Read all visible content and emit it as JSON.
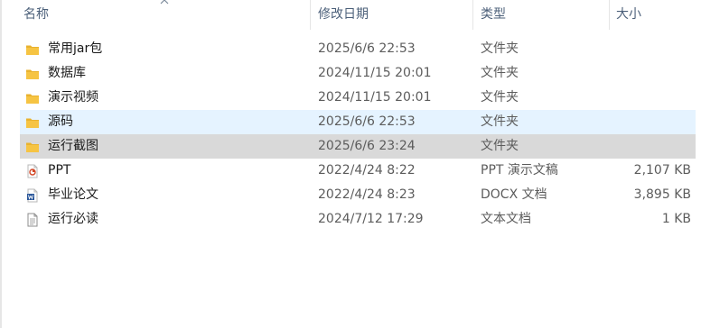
{
  "columns": {
    "name": "名称",
    "date": "修改日期",
    "type": "类型",
    "size": "大小"
  },
  "colors": {
    "hover": "#e5f3ff",
    "selected": "#d9d9d9",
    "folder": "#f6c443",
    "ppt": "#d24726",
    "word": "#2b579a"
  },
  "files": [
    {
      "name": "常用jar包",
      "date": "2025/6/6 22:53",
      "type": "文件夹",
      "size": "",
      "icon": "folder-icon",
      "state": ""
    },
    {
      "name": "数据库",
      "date": "2024/11/15 20:01",
      "type": "文件夹",
      "size": "",
      "icon": "folder-icon",
      "state": ""
    },
    {
      "name": "演示视频",
      "date": "2024/11/15 20:01",
      "type": "文件夹",
      "size": "",
      "icon": "folder-icon",
      "state": ""
    },
    {
      "name": "源码",
      "date": "2025/6/6 22:53",
      "type": "文件夹",
      "size": "",
      "icon": "folder-icon",
      "state": "hover"
    },
    {
      "name": "运行截图",
      "date": "2025/6/6 23:24",
      "type": "文件夹",
      "size": "",
      "icon": "folder-icon",
      "state": "selected"
    },
    {
      "name": "PPT",
      "date": "2022/4/24 8:22",
      "type": "PPT 演示文稿",
      "size": "2,107 KB",
      "icon": "ppt-file-icon",
      "state": ""
    },
    {
      "name": "毕业论文",
      "date": "2022/4/24 8:23",
      "type": "DOCX 文档",
      "size": "3,895 KB",
      "icon": "word-file-icon",
      "state": ""
    },
    {
      "name": "运行必读",
      "date": "2024/7/12 17:29",
      "type": "文本文档",
      "size": "1 KB",
      "icon": "text-file-icon",
      "state": ""
    }
  ]
}
